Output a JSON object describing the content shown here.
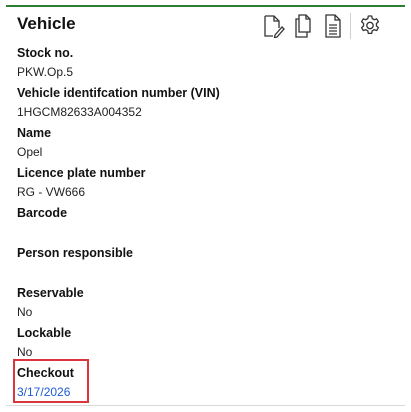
{
  "panel": {
    "title": "Vehicle",
    "toolbar": {
      "edit_icon": "edit-document-icon",
      "copy_icon": "copy-document-icon",
      "details_icon": "document-lines-icon",
      "settings_icon": "gear-icon"
    }
  },
  "fields": [
    {
      "label": "Stock no.",
      "value": "PKW.Op.5"
    },
    {
      "label": "Vehicle identifcation number (VIN)",
      "value": "1HGCM82633A004352"
    },
    {
      "label": "Name",
      "value": "Opel"
    },
    {
      "label": "Licence plate number",
      "value": "RG - VW666"
    },
    {
      "label": "Barcode",
      "value": ""
    },
    {
      "label": "Person responsible",
      "value": ""
    },
    {
      "label": "Reservable",
      "value": "No"
    },
    {
      "label": "Lockable",
      "value": "No"
    },
    {
      "label": "Checkout",
      "value": "3/17/2026"
    }
  ],
  "colors": {
    "accent_top": "#2e7d32",
    "link": "#1f5bd7",
    "highlight": "#d9363e"
  }
}
